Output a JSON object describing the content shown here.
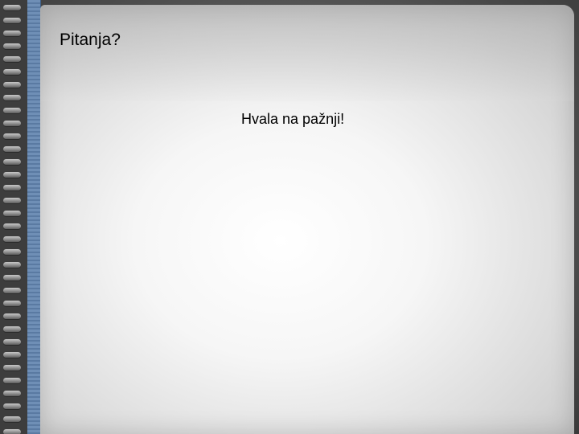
{
  "slide": {
    "title": "Pitanja?",
    "body": "Hvala na pažnji!"
  },
  "theme": {
    "spine_color": "#6f8fb6",
    "panel_color": "#f6f6f6",
    "frame_color": "#3d3d3d"
  }
}
